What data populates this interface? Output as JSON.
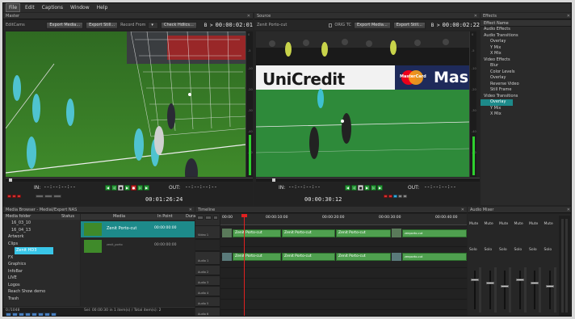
{
  "menu": [
    "File",
    "Edit",
    "Captions",
    "Window",
    "Help"
  ],
  "master": {
    "title": "Master",
    "name": "EditCams",
    "buttons": [
      "Export Media...",
      "Export Still...",
      "Record From",
      "Check Hdlics..."
    ],
    "b_label": "B >",
    "timecode": "00:00:02:01",
    "in_label": "IN:",
    "in_value": "--:--:--:--",
    "out_label": "OUT:",
    "out_value": "--:--:--:--",
    "position": "00:01:26:24",
    "scale_ticks": [
      "0",
      "-5",
      "-10",
      "-20",
      "-30",
      "-40",
      "-50"
    ]
  },
  "source": {
    "title": "Source",
    "clip_name": "Zenit Porto-cut",
    "checkbox_label": "ORIG TC",
    "buttons": [
      "Export Media...",
      "Export Still..."
    ],
    "b_label": "B >",
    "timecode": "00:00:02:22",
    "in_label": "IN:",
    "in_value": "--:--:--:--",
    "out_label": "OUT:",
    "out_value": "--:--:--:--",
    "position": "00:00:30:12",
    "scale_ticks": [
      "0",
      "-5",
      "-10",
      "-20",
      "-30",
      "-40",
      "-50"
    ],
    "banner_text": "UniCredit",
    "banner_brand2": "MasterCard",
    "banner_text2": "Mas"
  },
  "effects": {
    "title": "Effects",
    "header": "Effect Name",
    "items": [
      {
        "label": "Audio Effects",
        "level": 0
      },
      {
        "label": "Audio Transitions",
        "level": 0
      },
      {
        "label": "Overlay",
        "level": 1
      },
      {
        "label": "Y Mix",
        "level": 1
      },
      {
        "label": "X Mix",
        "level": 1
      },
      {
        "label": "Video Effects",
        "level": 0
      },
      {
        "label": "Blur",
        "level": 1
      },
      {
        "label": "Color Levels",
        "level": 1
      },
      {
        "label": "Overlay",
        "level": 1
      },
      {
        "label": "Reverse Video",
        "level": 1
      },
      {
        "label": "Still Frame",
        "level": 1
      },
      {
        "label": "Video Transitions",
        "level": 0
      },
      {
        "label": "Overlay",
        "level": 1,
        "selected": true
      },
      {
        "label": "Y Mix",
        "level": 1
      },
      {
        "label": "X Mix",
        "level": 1
      }
    ]
  },
  "media_browser": {
    "title": "Media Browser - Medial/Expert NAS",
    "col_folder": "Media folder",
    "col_status": "Status",
    "col_media": "Media",
    "col_in": "In Point",
    "col_dur": "Dura",
    "folders": [
      {
        "label": "16_03_10",
        "selected": false
      },
      {
        "label": "16_04_13",
        "selected": false
      },
      {
        "label": "Artwork",
        "selected": false
      },
      {
        "label": "Clips",
        "selected": false
      },
      {
        "label": "Zenit HD3",
        "selected": true
      },
      {
        "label": "FX",
        "selected": false
      },
      {
        "label": "Graphics",
        "selected": false
      },
      {
        "label": "InfoBar",
        "selected": false
      },
      {
        "label": "LIVE",
        "selected": false
      },
      {
        "label": "Logos",
        "selected": false
      },
      {
        "label": "Reach Show demo",
        "selected": false
      },
      {
        "label": "Trash",
        "selected": false
      }
    ],
    "rows": [
      {
        "name": "Zenit Porto-cut",
        "in": "00:00:00:00",
        "selected": true
      },
      {
        "name": "zenit_porto",
        "in": "00:00:00:00",
        "selected": false
      }
    ],
    "footer": "Sel: 00:00:30 in 1 item(s) / Total item(s): 2",
    "footer_left": "0:/1048"
  },
  "timeline": {
    "title": "Timeline",
    "ruler": [
      "00:00",
      "00:00:10:00",
      "00:00:20:00",
      "00:00:30:00",
      "00:00:40:00"
    ],
    "tracks": [
      "Video 1",
      "Audio 1",
      "Audio 2",
      "Audio 3",
      "Audio 4",
      "Audio 5",
      "Audio 6"
    ],
    "video_clips": [
      "Zenit Porto-cut",
      "Zenit Porto-cut",
      "Zenit Porto-cut",
      "zenporto-cut"
    ],
    "audio_clips": [
      "Zenit Porto-cut",
      "Zenit Porto-cut",
      "Zenit Porto-cut",
      "zenporto-cut"
    ]
  },
  "audio_mixer": {
    "title": "Audio Mixer",
    "channels": 6,
    "mute_label": "Mute",
    "solo_label": "Solo",
    "scale": [
      "12",
      "6",
      "0",
      "-6",
      "-12",
      "-18",
      "-24",
      "-30",
      "-36"
    ]
  },
  "colors": {
    "accent_green": "#4fa04f",
    "select_teal": "#1d8a8a",
    "select_blue": "#2e8fb0",
    "playhead_red": "#e02020"
  }
}
